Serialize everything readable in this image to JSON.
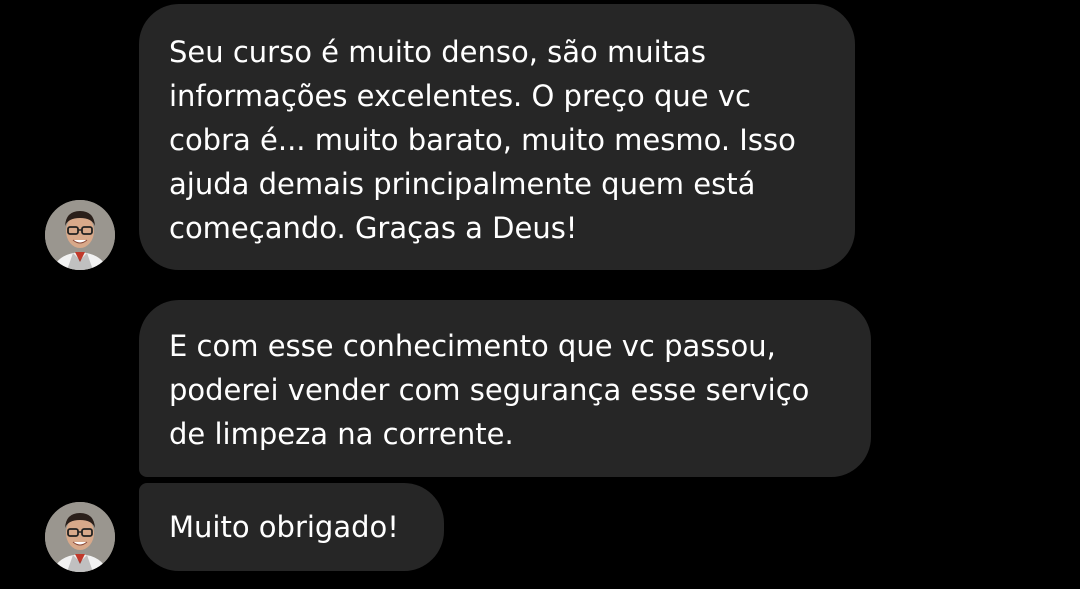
{
  "chat": {
    "messages": [
      {
        "lines": [
          "Seu curso é muito denso, são muitas",
          "informações excelentes. O preço que vc",
          "cobra é... muito barato, muito mesmo. Isso",
          "ajuda demais principalmente quem está",
          "começando. Graças a Deus!"
        ]
      },
      {
        "lines": [
          "E com esse conhecimento que vc passou,",
          "poderei vender com segurança esse serviço",
          "de limpeza na corrente."
        ]
      },
      {
        "lines": [
          "Muito obrigado!"
        ]
      }
    ]
  },
  "colors": {
    "background": "#000000",
    "bubble": "#262626",
    "text": "#ffffff"
  },
  "icons": {
    "avatar": "contact-avatar-photo"
  }
}
